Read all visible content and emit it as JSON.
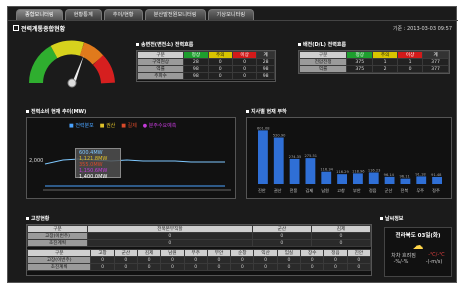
{
  "tabs": [
    "종합모니터링",
    "현황통계",
    "추이/현황",
    "분산발전원모니터링",
    "기상모니터링"
  ],
  "page_title": "전력계통종합현황",
  "date_label": "기준 : 2013-03-03 09:57",
  "sections": {
    "s1": "송변전(변전소) 전력흐름",
    "s2": "배전(D/L) 전력흐름",
    "s3": "전력소비 현재 추이(MW)",
    "s4": "지사별 현재 부하",
    "s5": "고장현황",
    "s6": "날씨정보"
  },
  "gauge_colors": [
    "#2fae2f",
    "#d7d21d",
    "#e07a1c",
    "#d61f1f"
  ],
  "table1": {
    "headers": [
      "구분",
      "정상",
      "주의",
      "이상",
      "계"
    ],
    "rows": [
      [
        "구역현상",
        "28",
        "0",
        "0",
        "28"
      ],
      [
        "역률",
        "98",
        "0",
        "0",
        "98"
      ],
      [
        "주파수",
        "98",
        "0",
        "0",
        "98"
      ]
    ]
  },
  "table2": {
    "headers": [
      "구분",
      "정상",
      "주의",
      "이상",
      "계"
    ],
    "rows": [
      [
        "전압전정",
        "375",
        "1",
        "1",
        "377"
      ],
      [
        "역률",
        "375",
        "2",
        "0",
        "377"
      ]
    ]
  },
  "line_legend": [
    "전력분포",
    "권산",
    "길제",
    "분주수요예측"
  ],
  "line_tooltip": [
    "600.4MW",
    "1,121.8MW",
    "355.0MW",
    "1,150.6MW",
    "1,400.0MW"
  ],
  "y_tick": "2,000",
  "chart_data": {
    "type": "bar",
    "categories": [
      "진안",
      "권산",
      "전풍",
      "김제",
      "남원",
      "고창",
      "부안",
      "정읍",
      "군산",
      "전북",
      "무주",
      "정주"
    ],
    "values": [
      601,
      521,
      281,
      290,
      138,
      110,
      119,
      129,
      80,
      60,
      85,
      79
    ],
    "labels": [
      "601.08",
      "520.90",
      "274.35",
      "275.51",
      "116.34",
      "116.29",
      "118.96",
      "116.23",
      "96.14",
      "96.11",
      "91.18",
      "91.48"
    ]
  },
  "fault": {
    "row1": [
      "구분",
      "전북본부직할",
      "군산",
      "김제"
    ],
    "row2": [
      "고장(이번주)",
      "0",
      "0",
      "0"
    ],
    "row3": [
      "초진계획",
      "0",
      "0",
      "0"
    ],
    "row4": [
      "구분",
      "고창",
      "군산",
      "김제",
      "남원",
      "무주",
      "부안",
      "순창",
      "익산",
      "임실",
      "장수",
      "정읍",
      "진안"
    ],
    "row5": [
      "고장(이번주)",
      "0",
      "0",
      "0",
      "0",
      "0",
      "0",
      "0",
      "0",
      "0",
      "0",
      "0",
      "0"
    ],
    "row6": [
      "초진계획",
      "0",
      "0",
      "0",
      "0",
      "0",
      "0",
      "0",
      "0",
      "0",
      "0",
      "0",
      "0"
    ]
  },
  "weather": {
    "title": "전라북도 03일(화)",
    "label": "차차 흐려짐",
    "t1": "-%/-%",
    "t2": "-℃/-℃",
    "t3": "-(-m/s)"
  }
}
